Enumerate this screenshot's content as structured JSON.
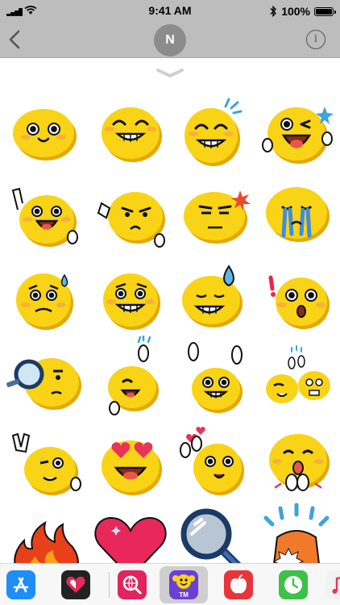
{
  "status_bar": {
    "time": "9:41 AM",
    "battery": "100%",
    "battery_level": 1.0
  },
  "nav": {
    "avatar_initial": "N",
    "back_icon": "chevron-left-icon",
    "info_icon": "info-circle-icon",
    "info_glyph": "i"
  },
  "drawer": {
    "handle_icon": "chevron-down-icon"
  },
  "stickers": [
    {
      "name": "sticker-happy-smile",
      "mood": "smile"
    },
    {
      "name": "sticker-big-grin",
      "mood": "grin"
    },
    {
      "name": "sticker-laughing-sweat",
      "mood": "laugh-sweat"
    },
    {
      "name": "sticker-wink-laugh",
      "mood": "wink"
    },
    {
      "name": "sticker-thumbs-up",
      "mood": "thumbs-up"
    },
    {
      "name": "sticker-thumbs-down",
      "mood": "thumbs-down"
    },
    {
      "name": "sticker-annoyed",
      "mood": "annoyed"
    },
    {
      "name": "sticker-crying",
      "mood": "crying"
    },
    {
      "name": "sticker-worried",
      "mood": "worried"
    },
    {
      "name": "sticker-nervous-grin",
      "mood": "nervous"
    },
    {
      "name": "sticker-sweating-grin",
      "mood": "sweat-grin"
    },
    {
      "name": "sticker-surprised",
      "mood": "surprised"
    },
    {
      "name": "sticker-magnifier-look",
      "mood": "magnifier"
    },
    {
      "name": "sticker-high-five",
      "mood": "high-five"
    },
    {
      "name": "sticker-hands-up",
      "mood": "hands-up"
    },
    {
      "name": "sticker-pair-high-five",
      "mood": "pair"
    },
    {
      "name": "sticker-peace-wink",
      "mood": "peace"
    },
    {
      "name": "sticker-heart-eyes",
      "mood": "heart-eyes"
    },
    {
      "name": "sticker-hearts-wave",
      "mood": "hearts-wave"
    },
    {
      "name": "sticker-clapping",
      "mood": "clapping"
    },
    {
      "name": "sticker-fire",
      "mood": "fire"
    },
    {
      "name": "sticker-heart",
      "mood": "heart"
    },
    {
      "name": "sticker-magnifying-glass",
      "mood": "magnifying-glass"
    },
    {
      "name": "sticker-siren",
      "mood": "siren"
    }
  ],
  "dock": {
    "icons": [
      {
        "name": "app-store-icon",
        "color": "#1e8ef5"
      },
      {
        "name": "heart-app-icon",
        "color": "#222222"
      },
      {
        "name": "web-search-icon",
        "color": "#e0245e"
      },
      {
        "name": "emoji-sticker-app-icon",
        "color": "#6b3fd6",
        "label": "TM"
      },
      {
        "name": "red-app-icon",
        "color": "#e8343a"
      },
      {
        "name": "clock-app-icon",
        "color": "#3cc14a"
      },
      {
        "name": "music-app-icon",
        "color": "#f2f2f2"
      }
    ]
  },
  "colors": {
    "bar_gray": "#bdbdbd",
    "emoji_yellow": "#f9d315",
    "emoji_shadow": "#e6a800"
  }
}
